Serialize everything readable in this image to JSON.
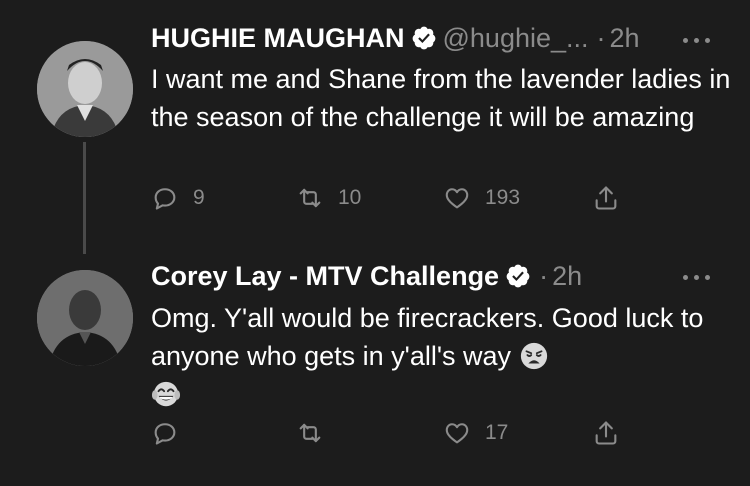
{
  "tweets": [
    {
      "name": "HUGHIE MAUGHAN",
      "handle": "@hughie_...",
      "separator": "·",
      "time": "2h",
      "text": "I want me and Shane from the lavender ladies in the season of the challenge it will be amazing",
      "replies": "9",
      "retweets": "10",
      "likes": "193"
    },
    {
      "name": "Corey Lay - MTV Challenge",
      "separator": "·",
      "time": "2h",
      "text": "Omg. Y'all would be firecrackers. Good luck to anyone who gets in y'all's way",
      "emojis": [
        "weary-face",
        "tears-of-joy-face"
      ],
      "likes": "17"
    }
  ],
  "colors": {
    "background": "#1c1c1c",
    "text": "#ffffff",
    "muted": "#8b8b8b",
    "thread_line": "#4a4a4a"
  },
  "icons": [
    "verified-badge-icon",
    "more-icon",
    "reply-icon",
    "retweet-icon",
    "like-icon",
    "share-icon"
  ]
}
